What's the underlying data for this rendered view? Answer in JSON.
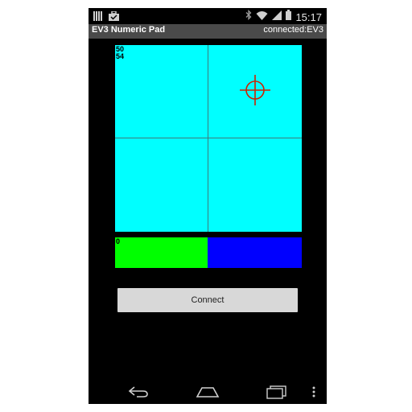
{
  "status_bar": {
    "time": "15:17",
    "icons": [
      "notification-icon",
      "briefcase-icon",
      "bluetooth-icon",
      "wifi-icon",
      "signal-icon",
      "battery-icon"
    ]
  },
  "action_bar": {
    "title": "EV3 Numeric Pad",
    "connection_status": "connected:EV3"
  },
  "pad": {
    "readout_x": "50",
    "readout_y": "54",
    "background_color": "#00ffff",
    "crosshair_color": "#cc2200"
  },
  "bars": {
    "left_value": "0",
    "left_color": "#00ff00",
    "right_color": "#0000ff"
  },
  "connect_button": {
    "label": "Connect"
  },
  "nav_bar": {
    "icons": [
      "back-icon",
      "home-icon",
      "recents-icon",
      "overflow-menu-icon"
    ]
  }
}
